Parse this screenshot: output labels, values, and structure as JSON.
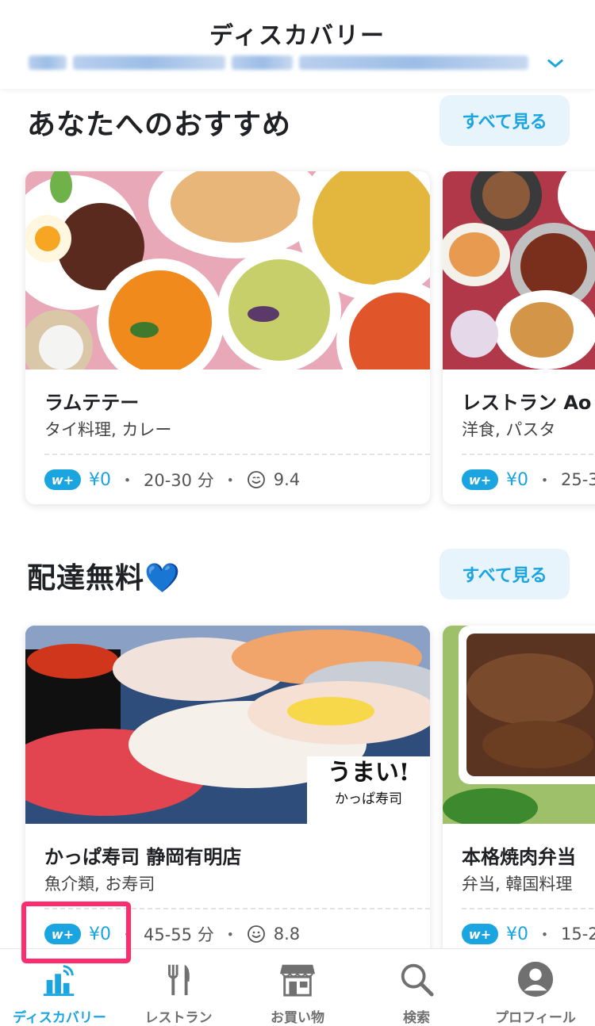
{
  "header": {
    "title": "ディスカバリー"
  },
  "sections": [
    {
      "title": "あなたへのおすすめ",
      "see_all": "すべて見る",
      "cards": [
        {
          "name": "ラムテテー",
          "categories": "タイ料理, カレー",
          "badge": "w+",
          "fee": "¥0",
          "sep": "・",
          "time": "20-30 分",
          "rating": "9.4"
        },
        {
          "name": "レストラン Ao",
          "categories": "洋食, パスタ",
          "badge": "w+",
          "fee": "¥0",
          "sep": "・",
          "time": "25-3"
        }
      ]
    },
    {
      "title": "配達無料💙",
      "see_all": "すべて見る",
      "cards": [
        {
          "name": "かっぱ寿司 静岡有明店",
          "categories": "魚介類, お寿司",
          "badge": "w+",
          "fee": "¥0",
          "sep": "・",
          "time": "45-55 分",
          "rating": "8.8",
          "logo_text": [
            "うまい!",
            "かっぱ寿司"
          ]
        },
        {
          "name": "本格焼肉弁当",
          "categories": "弁当, 韓国料理",
          "badge": "w+",
          "fee": "¥0",
          "sep": "・",
          "time": "15-2"
        }
      ]
    }
  ],
  "nav": [
    {
      "label": "ディスカバリー",
      "icon": "discovery-icon",
      "active": true
    },
    {
      "label": "レストラン",
      "icon": "fork-knife-icon",
      "active": false
    },
    {
      "label": "お買い物",
      "icon": "store-icon",
      "active": false
    },
    {
      "label": "検索",
      "icon": "search-icon",
      "active": false
    },
    {
      "label": "プロフィール",
      "icon": "profile-icon",
      "active": false
    }
  ],
  "colors": {
    "accent": "#1aa4e0",
    "highlight": "#ff2d6f",
    "see_all_bg": "#e8f4fb"
  }
}
